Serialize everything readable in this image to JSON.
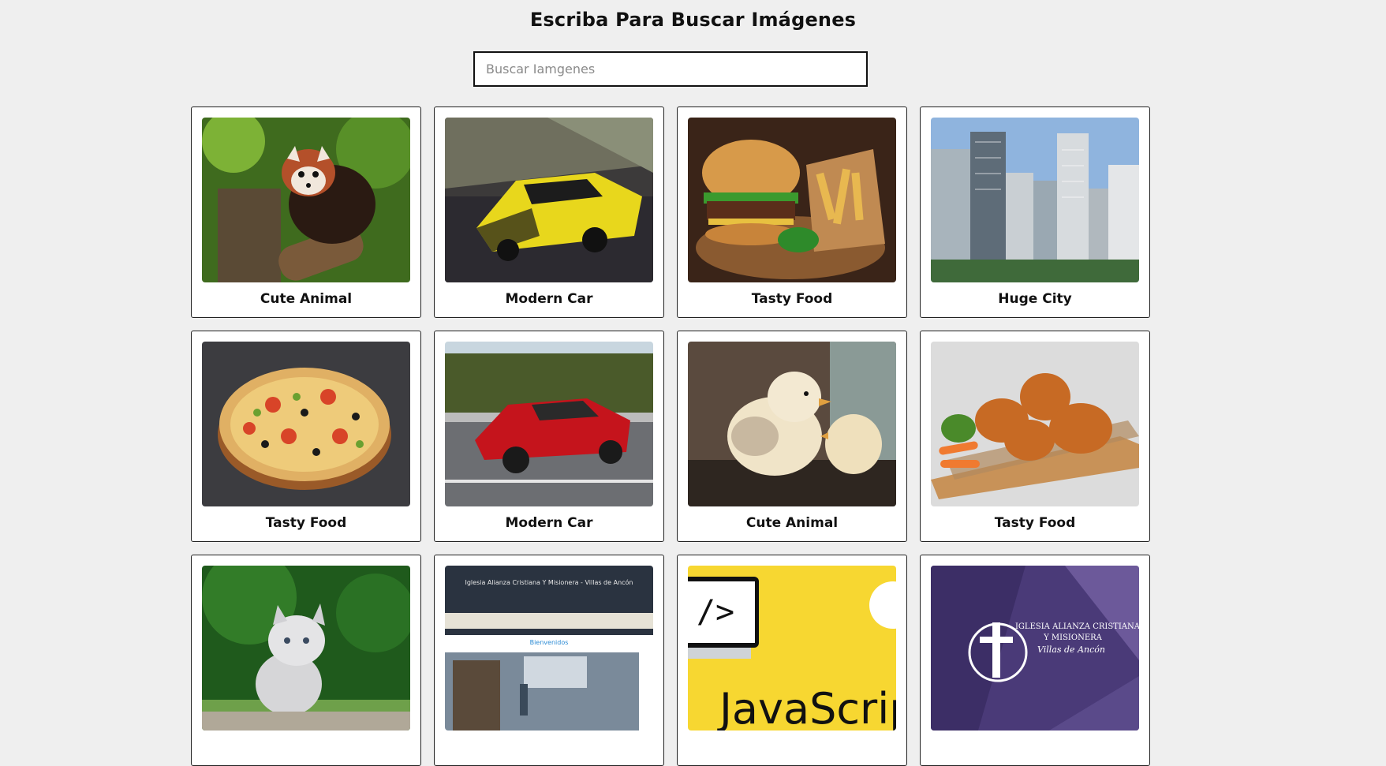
{
  "header": {
    "title": "Escriba Para Buscar Imágenes"
  },
  "search": {
    "placeholder": "Buscar Iamgenes",
    "value": ""
  },
  "cards": [
    {
      "caption": "Cute Animal",
      "subject": "red panda on tree stump"
    },
    {
      "caption": "Modern Car",
      "subject": "yellow sports car on road"
    },
    {
      "caption": "Tasty Food",
      "subject": "burger and fries on wooden board"
    },
    {
      "caption": "Huge City",
      "subject": "skyscrapers skyline"
    },
    {
      "caption": "Tasty Food",
      "subject": "pizza"
    },
    {
      "caption": "Modern Car",
      "subject": "red sports car on highway"
    },
    {
      "caption": "Cute Animal",
      "subject": "baby chicks"
    },
    {
      "caption": "Tasty Food",
      "subject": "fried chicken with carrots"
    },
    {
      "caption": "",
      "subject": "white kitten on grass"
    },
    {
      "caption": "",
      "subject": "church website screenshot",
      "embedded_text": [
        "Iglesia Alianza Cristiana Y Misionera - Villas de Ancón",
        "Bienvenidos"
      ]
    },
    {
      "caption": "",
      "subject": "JavaScript banner",
      "embedded_text": [
        "JavaScrip"
      ]
    },
    {
      "caption": "",
      "subject": "church logo on purple",
      "embedded_text": [
        "IGLESIA ALIANZA CRISTIANA",
        "Y MISIONERA",
        "Villas de Ancón"
      ]
    }
  ],
  "colors": {
    "background": "#efefef",
    "card_border": "#222222",
    "js_yellow": "#f7d731",
    "church_purple": "#4a3a78"
  }
}
